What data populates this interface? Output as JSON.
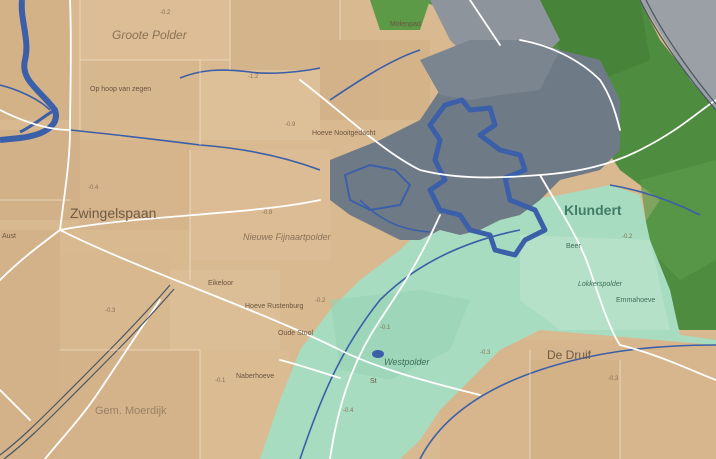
{
  "map": {
    "labels": {
      "groote_polder": "Groote Polder",
      "op_hoop_van_zegen": "Op hoop van zegen",
      "zwingelspaan": "Zwingelspaan",
      "hoeve_nooitgedacht": "Hoeve Nooitgedacht",
      "nieuwe_fijnaartpolder": "Nieuwe Fijnaartpolder",
      "klundert": "Klundert",
      "beer": "Beer",
      "lokkerspolder": "Lokkerspolder",
      "emmahoeve": "Emmahoeve",
      "westpolder": "Westpolder",
      "de_druif": "De Druif",
      "gem_moerdijk": "Gem. Moerdijk",
      "hoeve_rustenburg": "Hoeve Rustenburg",
      "oude_stool": "Oude Stool",
      "naberhoeve": "Naberhoeve",
      "eikeloor": "Eikeloor",
      "molenpad": "Molenpad",
      "aust": "Aust",
      "st": "St"
    },
    "depth_values": [
      "-0.2",
      "-1.2",
      "-0.9",
      "-0.4",
      "-0.8",
      "-0.2",
      "-0.3",
      "-0.1",
      "-0.3",
      "-0.1",
      "-0.4",
      "-0.2",
      "-0.3"
    ],
    "colors": {
      "farmland": "#d9b98f",
      "urban": "#6f7a87",
      "urban_dark": "#4a5663",
      "flood_zone": "#a8dcc0",
      "forest": "#4e8c3f",
      "water": "#3b5fa8",
      "road": "#ffffff"
    }
  }
}
